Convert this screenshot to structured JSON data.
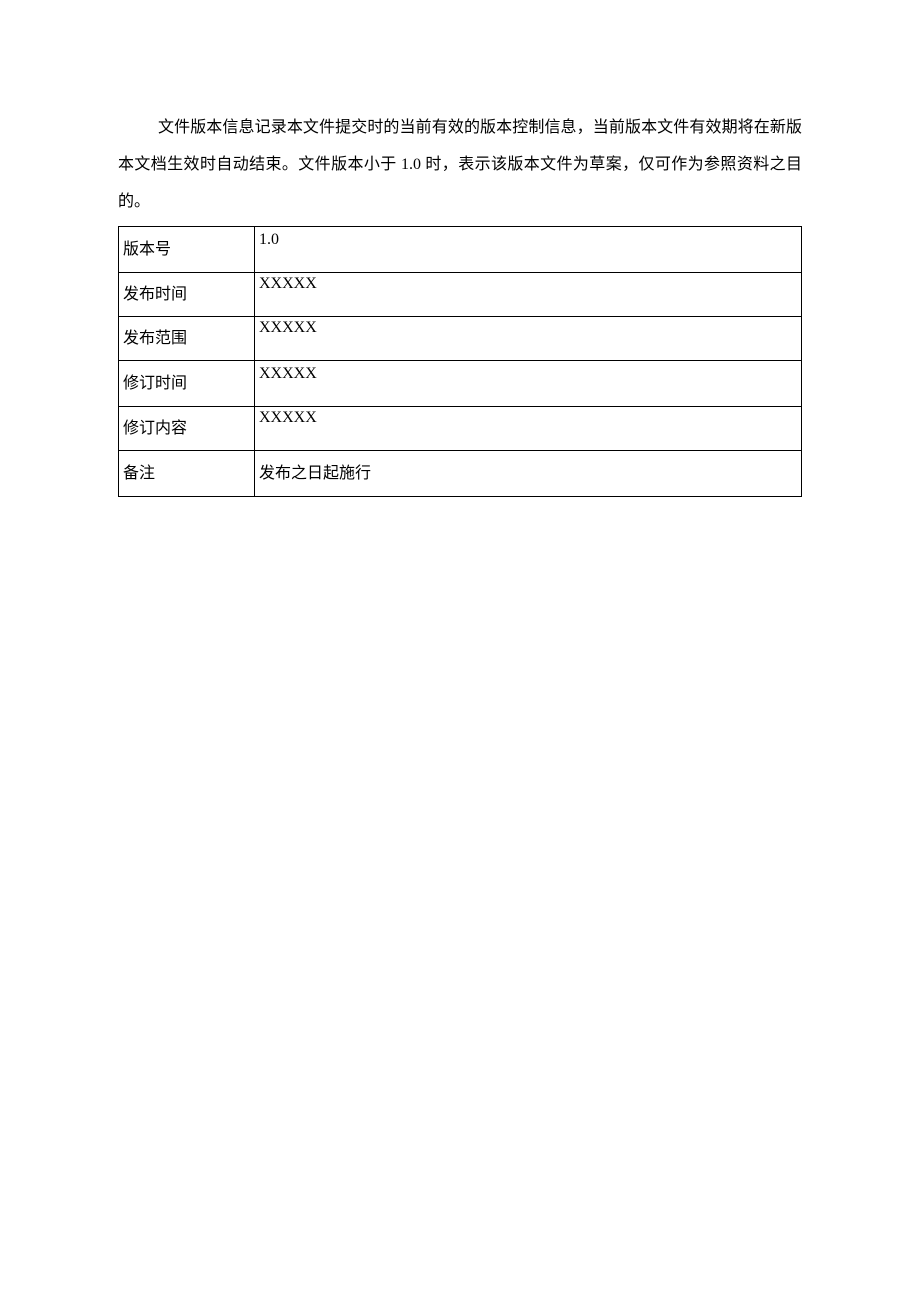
{
  "paragraph": {
    "text": "文件版本信息记录本文件提交时的当前有效的版本控制信息，当前版本文件有效期将在新版本文档生效时自动结束。文件版本小于 1.0 时，表示该版本文件为草案，仅可作为参照资料之目的。"
  },
  "table": {
    "rows": [
      {
        "label": "版本号",
        "value": "1.0"
      },
      {
        "label": "发布时间",
        "value": "XXXXX"
      },
      {
        "label": "发布范围",
        "value": "XXXXX"
      },
      {
        "label": "修订时间",
        "value": "XXXXX"
      },
      {
        "label": "修订内容",
        "value": "XXXXX"
      },
      {
        "label": "备注",
        "value": "发布之日起施行"
      }
    ]
  }
}
